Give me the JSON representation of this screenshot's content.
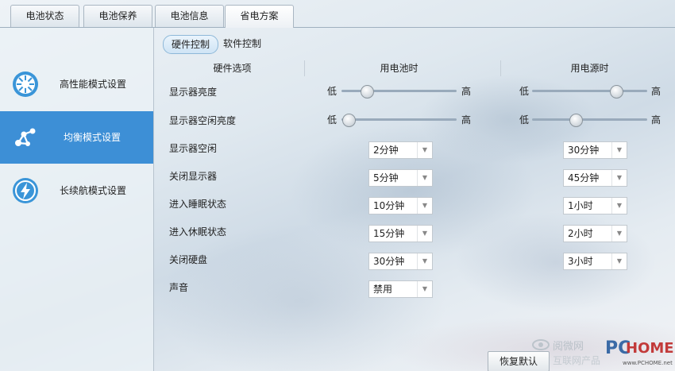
{
  "tabs": [
    {
      "label": "电池状态"
    },
    {
      "label": "电池保养"
    },
    {
      "label": "电池信息"
    },
    {
      "label": "省电方案"
    }
  ],
  "sidebar": {
    "items": [
      {
        "label": "高性能模式设置",
        "icon": "sun-icon"
      },
      {
        "label": "均衡模式设置",
        "icon": "molecule-icon"
      },
      {
        "label": "长续航模式设置",
        "icon": "lightning-icon"
      }
    ],
    "active_index": 1
  },
  "subtabs": [
    {
      "label": "硬件控制"
    },
    {
      "label": "软件控制"
    }
  ],
  "headers": {
    "options": "硬件选项",
    "battery": "用电池时",
    "ac": "用电源时"
  },
  "brightness_labels": {
    "low": "低",
    "high": "高"
  },
  "rows": [
    {
      "label": "显示器亮度",
      "battery_level": 0.22,
      "ac_level": 0.73
    },
    {
      "label": "显示器空闲亮度",
      "battery_level": 0.06,
      "ac_level": 0.38
    },
    {
      "label": "显示器空闲",
      "battery": "2分钟",
      "ac": "30分钟"
    },
    {
      "label": "关闭显示器",
      "battery": "5分钟",
      "ac": "45分钟"
    },
    {
      "label": "进入睡眠状态",
      "battery": "10分钟",
      "ac": "1小时"
    },
    {
      "label": "进入休眠状态",
      "battery": "15分钟",
      "ac": "2小时"
    },
    {
      "label": "关闭硬盘",
      "battery": "30分钟",
      "ac": "3小时"
    },
    {
      "label": "声音",
      "battery": "禁用"
    }
  ],
  "restore_button": "恢复默认",
  "watermark": {
    "line1": "阅微网",
    "line2": "互联网产品",
    "pc": "PC",
    "home": "HOME",
    "url": "www.PCHOME.net"
  },
  "colors": {
    "accent": "#3d8fd6"
  }
}
